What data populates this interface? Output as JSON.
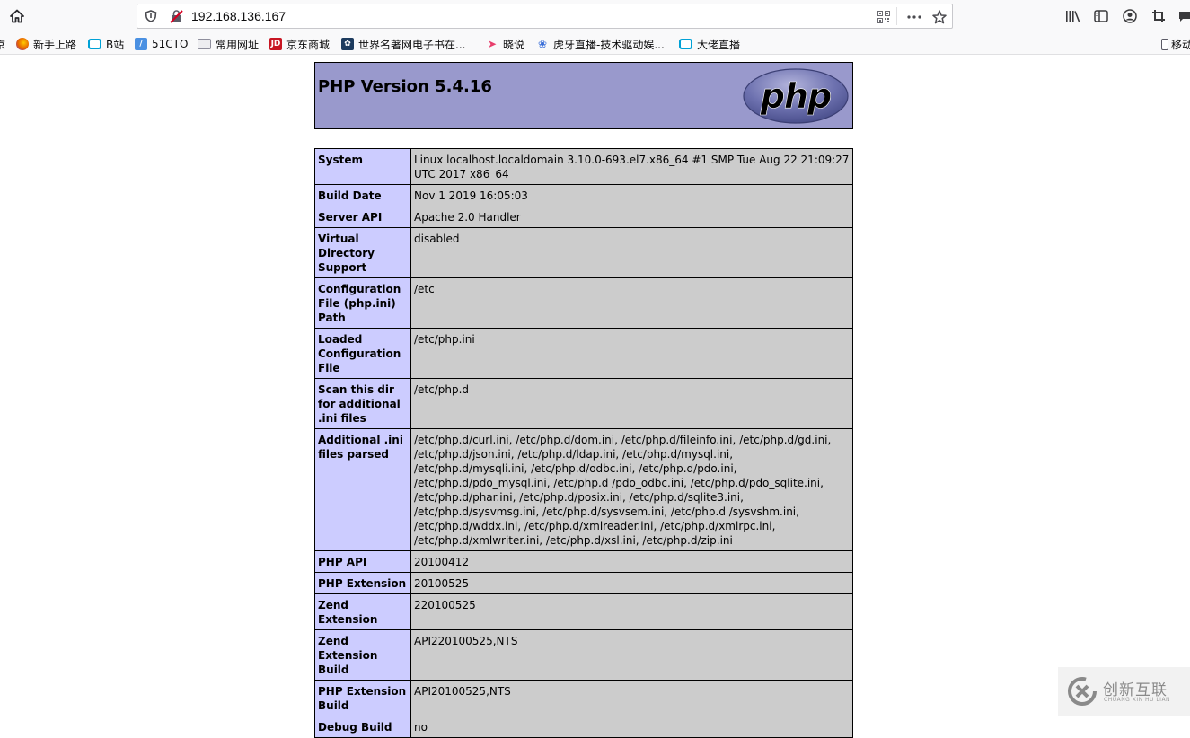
{
  "browser": {
    "url": "192.168.136.167",
    "toolbar_icons": [
      "home-icon",
      "shield-icon",
      "insecure-lock-icon",
      "qr-code-icon",
      "more-icon",
      "star-icon",
      "library-icon",
      "sidebar-icon",
      "account-icon",
      "screenshot-icon",
      "chat-icon"
    ],
    "bookmarks": [
      {
        "label": "京",
        "icon": "none"
      },
      {
        "label": "新手上路",
        "icon": "firefox-icon",
        "color": "#e66000"
      },
      {
        "label": "B站",
        "icon": "bilibili-icon",
        "color": "#00a1d6"
      },
      {
        "label": "51CTO",
        "icon": "feather-icon",
        "color": "#4a90e2"
      },
      {
        "label": "常用网址",
        "icon": "folder-icon",
        "color": "#8f8f9d"
      },
      {
        "label": "京东商城",
        "icon": "jd-icon",
        "color": "#c81623"
      },
      {
        "label": "世界名著网电子书在...",
        "icon": "book-site-icon",
        "color": "#1d3b5e"
      },
      {
        "label": "晓说",
        "icon": "play-icon",
        "color": "#e83e6c"
      },
      {
        "label": "虎牙直播-技术驱动娱...",
        "icon": "paw-icon",
        "color": "#3a6fd8"
      },
      {
        "label": "大佬直播",
        "icon": "bilibili-icon",
        "color": "#00a1d6"
      }
    ],
    "mobile_bookmarks": "移动"
  },
  "phpinfo": {
    "title": "PHP Version 5.4.16",
    "logo_text": "php",
    "colors": {
      "header_bg": "#9999cc",
      "key_bg": "#ccccff",
      "value_bg": "#cccccc"
    },
    "rows": [
      {
        "key": "System",
        "value": "Linux localhost.localdomain 3.10.0-693.el7.x86_64 #1 SMP Tue Aug 22 21:09:27 UTC 2017 x86_64"
      },
      {
        "key": "Build Date",
        "value": "Nov 1 2019 16:05:03"
      },
      {
        "key": "Server API",
        "value": "Apache 2.0 Handler"
      },
      {
        "key": "Virtual Directory Support",
        "value": "disabled"
      },
      {
        "key": "Configuration File (php.ini) Path",
        "value": "/etc"
      },
      {
        "key": "Loaded Configuration File",
        "value": "/etc/php.ini"
      },
      {
        "key": "Scan this dir for additional .ini files",
        "value": "/etc/php.d"
      },
      {
        "key": "Additional .ini files parsed",
        "value": "/etc/php.d/curl.ini, /etc/php.d/dom.ini, /etc/php.d/fileinfo.ini, /etc/php.d/gd.ini, /etc/php.d/json.ini, /etc/php.d/ldap.ini, /etc/php.d/mysql.ini, /etc/php.d/mysqli.ini, /etc/php.d/odbc.ini, /etc/php.d/pdo.ini, /etc/php.d/pdo_mysql.ini, /etc/php.d /pdo_odbc.ini, /etc/php.d/pdo_sqlite.ini, /etc/php.d/phar.ini, /etc/php.d/posix.ini, /etc/php.d/sqlite3.ini, /etc/php.d/sysvmsg.ini, /etc/php.d/sysvsem.ini, /etc/php.d /sysvshm.ini, /etc/php.d/wddx.ini, /etc/php.d/xmlreader.ini, /etc/php.d/xmlrpc.ini, /etc/php.d/xmlwriter.ini, /etc/php.d/xsl.ini, /etc/php.d/zip.ini"
      },
      {
        "key": "PHP API",
        "value": "20100412"
      },
      {
        "key": "PHP Extension",
        "value": "20100525"
      },
      {
        "key": "Zend Extension",
        "value": "220100525"
      },
      {
        "key": "Zend Extension Build",
        "value": "API220100525,NTS"
      },
      {
        "key": "PHP Extension Build",
        "value": "API20100525,NTS"
      },
      {
        "key": "Debug Build",
        "value": "no"
      }
    ]
  },
  "watermark": {
    "title": "创新互联",
    "subtitle": "CHUANG XIN HU LIAN"
  }
}
